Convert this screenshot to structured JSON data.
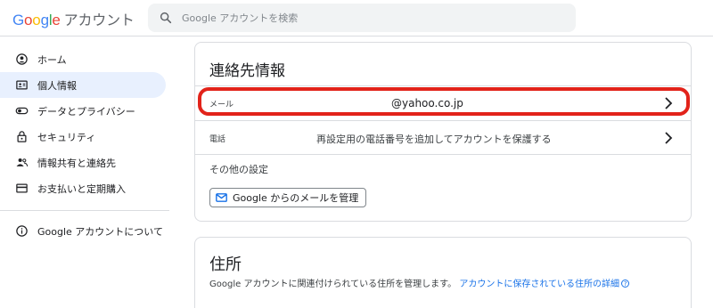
{
  "header": {
    "logo_letters": [
      "G",
      "o",
      "o",
      "g",
      "l",
      "e"
    ],
    "product": "アカウント",
    "search_placeholder": "Google アカウントを検索"
  },
  "sidebar": {
    "items": [
      {
        "label": "ホーム",
        "icon": "home-icon",
        "active": false
      },
      {
        "label": "個人情報",
        "icon": "id-card-icon",
        "active": true
      },
      {
        "label": "データとプライバシー",
        "icon": "toggle-icon",
        "active": false
      },
      {
        "label": "セキュリティ",
        "icon": "lock-icon",
        "active": false
      },
      {
        "label": "情報共有と連絡先",
        "icon": "people-icon",
        "active": false
      },
      {
        "label": "お支払いと定期購入",
        "icon": "credit-card-icon",
        "active": false
      }
    ],
    "about": {
      "label": "Google アカウントについて",
      "icon": "info-icon"
    }
  },
  "contact_card": {
    "title": "連絡先情報",
    "email_label": "メール",
    "email_value": "@yahoo.co.jp",
    "phone_label": "電話",
    "phone_value": "再設定用の電話番号を追加してアカウントを保護する",
    "other_settings": "その他の設定",
    "manage_button": "Google からのメールを管理"
  },
  "address_card": {
    "title": "住所",
    "description": "Google アカウントに関連付けられている住所を管理します。",
    "link": "アカウントに保存されている住所の詳細",
    "help_glyph": "?"
  },
  "colors": {
    "accent": "#1a73e8",
    "active_bg": "#e8f0fe",
    "highlight": "#e2231a"
  }
}
